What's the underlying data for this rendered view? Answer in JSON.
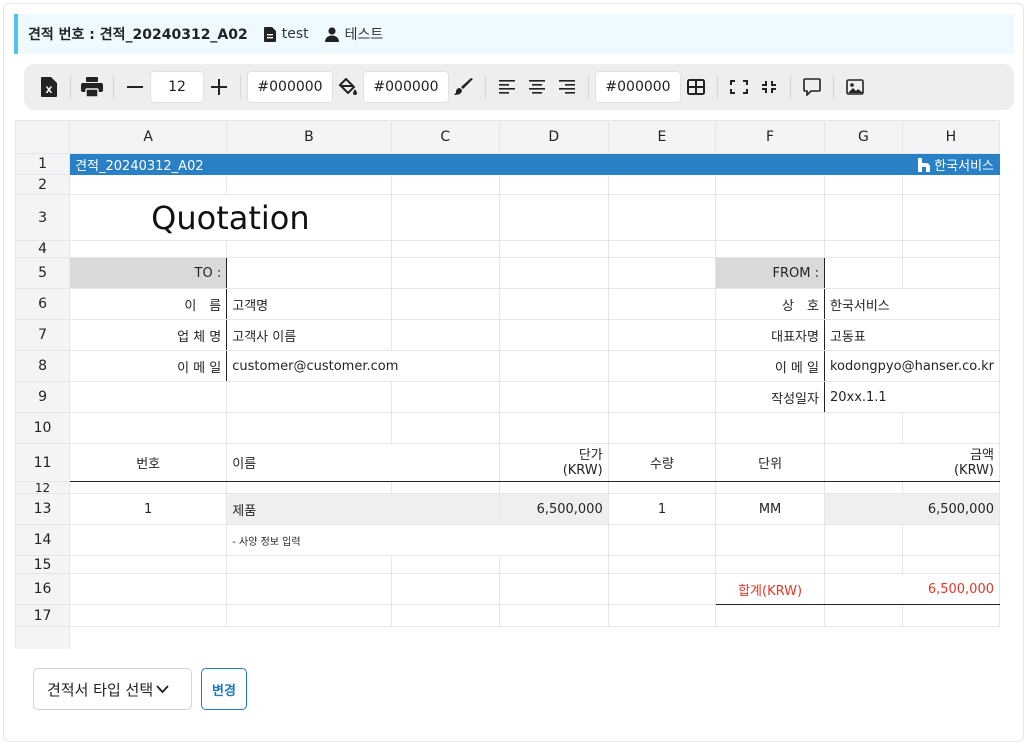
{
  "info": {
    "quote_number": "견적 번호 : 견적_20240312_A02",
    "file_name": "test",
    "user_name": "테스트"
  },
  "toolbar": {
    "font_size": "12",
    "text_color": "#000000",
    "fill_color": "#000000",
    "border_color": "#000000",
    "icons": [
      "excel-export-icon",
      "print-icon",
      "minus-icon",
      "plus-icon",
      "paint-bucket-icon",
      "brush-icon",
      "align-left-icon",
      "align-center-icon",
      "align-right-icon",
      "border-grid-icon",
      "merge-cells-icon",
      "split-cells-icon",
      "comment-icon",
      "image-icon"
    ]
  },
  "sheet": {
    "columns": [
      "A",
      "B",
      "C",
      "D",
      "E",
      "F",
      "G",
      "H"
    ],
    "rows": [
      "1",
      "2",
      "3",
      "4",
      "5",
      "6",
      "7",
      "8",
      "9",
      "10",
      "11",
      "12",
      "13",
      "14",
      "15",
      "16",
      "17"
    ],
    "banner_title": "견적_20240312_A02",
    "company_logo_text": "한국서비스",
    "title": "Quotation",
    "to_label": "TO :",
    "from_label": "FROM :",
    "to": {
      "name_label": "이　름",
      "name_value": "고객명",
      "company_label": "업 체 명",
      "company_value": "고객사 이름",
      "email_label": "이 메 일",
      "email_value": "customer@customer.com"
    },
    "from": {
      "company_label": "상　호",
      "company_value": "한국서비스",
      "ceo_label": "대표자명",
      "ceo_value": "고동표",
      "email_label": "이 메 일",
      "email_value": "kodongpyo@hanser.co.kr",
      "date_label": "작성일자",
      "date_value": "20xx.1.1"
    },
    "item_header": {
      "no": "번호",
      "name": "이름",
      "unit_price_1": "단가",
      "unit_price_2": "(KRW)",
      "qty": "수량",
      "unit": "단위",
      "amount_1": "금액",
      "amount_2": "(KRW)"
    },
    "item": {
      "no": "1",
      "name": "제품",
      "unit_price": "6,500,000",
      "qty": "1",
      "unit": "MM",
      "amount": "6,500,000",
      "spec": "- 사양 정보 입력"
    },
    "total_label": "합계(KRW)",
    "total_value": "6,500,000"
  },
  "controls": {
    "select_label": "견적서 타입 선택",
    "change_button": "변경"
  },
  "colors": {
    "banner": "#2980c4",
    "accent_info": "#4cc4ee",
    "total_text": "#e03a2a",
    "button_outline": "#1f7bbf"
  }
}
